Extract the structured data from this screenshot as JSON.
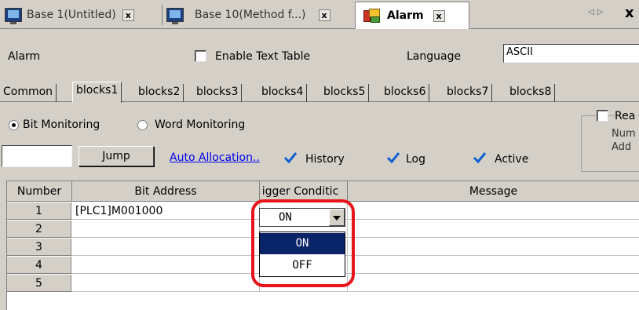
{
  "doc_tabs": [
    {
      "label": "Base 1(Untitled)",
      "icon": "monitor-icon"
    },
    {
      "label": "Base 10(Method f...)",
      "icon": "monitor-icon"
    },
    {
      "label": "Alarm",
      "icon": "alarm-icon"
    }
  ],
  "close_glyph": "x",
  "nav_arrows": "◁▷",
  "strip_close": "x",
  "settings": {
    "title": "Alarm",
    "enable_text_table": "Enable Text Table",
    "language_label": "Language",
    "language_value": "ASCII"
  },
  "block_tabs": [
    "Common",
    "blocks1",
    "blocks2",
    "blocks3",
    "blocks4",
    "blocks5",
    "blocks6",
    "blocks7",
    "blocks8"
  ],
  "active_block_tab": "blocks1",
  "monitoring": {
    "bit_label": "Bit Monitoring",
    "word_label": "Word Monitoring",
    "jump_label": "Jump",
    "auto_allocation": "Auto Allocation..",
    "history": "History",
    "log": "Log",
    "active": "Active",
    "group_title": "Rea",
    "group_line1": "Num",
    "group_line2": "Add"
  },
  "table": {
    "headers": [
      "Number",
      "Bit Address",
      "igger Conditic",
      "Message"
    ],
    "rows": [
      {
        "num": "1",
        "address": "[PLC1]M001000"
      },
      {
        "num": "2",
        "address": ""
      },
      {
        "num": "3",
        "address": ""
      },
      {
        "num": "4",
        "address": ""
      },
      {
        "num": "5",
        "address": ""
      }
    ]
  },
  "trigger": {
    "value": "ON",
    "options": [
      "ON",
      "OFF"
    ]
  },
  "colors": {
    "highlight": "#e8141c",
    "selection": "#0a246a",
    "link": "#0000ee"
  }
}
